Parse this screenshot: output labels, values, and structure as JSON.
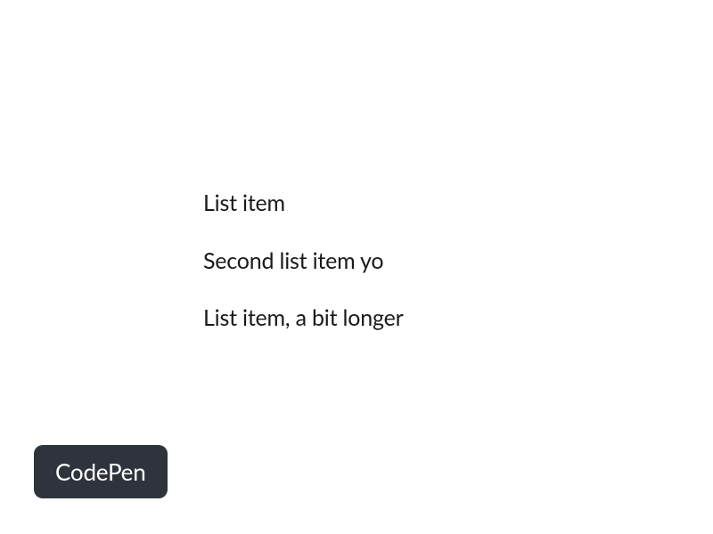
{
  "list": {
    "items": [
      "List item",
      "Second list item yo",
      "List item, a bit longer"
    ]
  },
  "badge": {
    "label": "CodePen"
  }
}
